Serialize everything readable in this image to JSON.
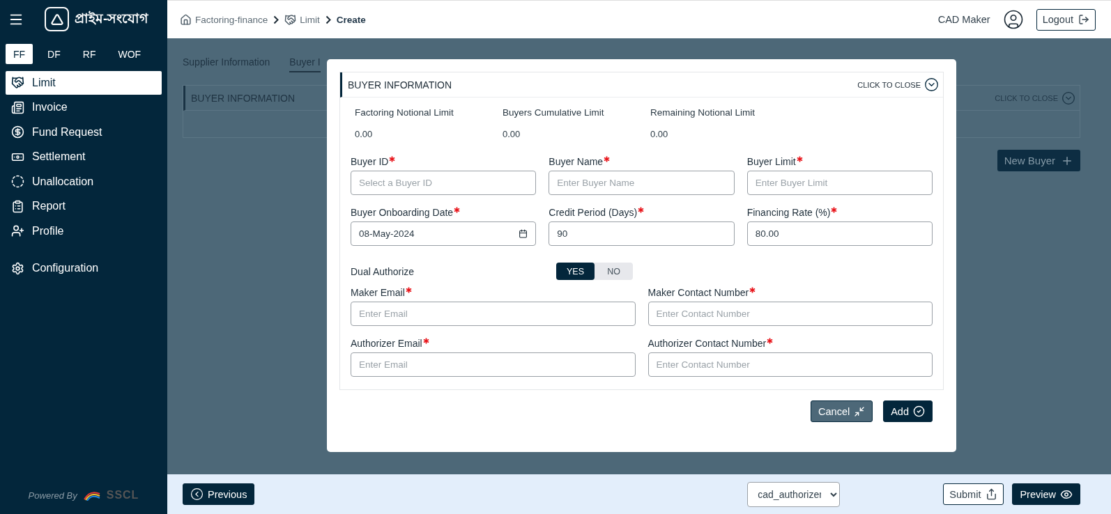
{
  "sidebar": {
    "brand": "প্রাইম-সংযোগ",
    "product_tabs": [
      {
        "label": "FF",
        "selected": true
      },
      {
        "label": "DF",
        "selected": false
      },
      {
        "label": "RF",
        "selected": false
      },
      {
        "label": "WOF",
        "selected": false
      }
    ],
    "items": [
      {
        "label": "Limit",
        "selected": true
      },
      {
        "label": "Invoice",
        "selected": false
      },
      {
        "label": "Fund Request",
        "selected": false
      },
      {
        "label": "Settlement",
        "selected": false
      },
      {
        "label": "Unallocation",
        "selected": false
      },
      {
        "label": "Report",
        "selected": false
      },
      {
        "label": "Profile",
        "selected": false
      }
    ],
    "footer_items": [
      {
        "label": "Configuration",
        "selected": false
      }
    ],
    "powered_by": "Powered By",
    "powered_logo": "SSCL"
  },
  "header": {
    "breadcrumb": [
      {
        "label": "Factoring-finance"
      },
      {
        "label": "Limit"
      },
      {
        "label": "Create"
      }
    ],
    "user": "CAD Maker",
    "logout": "Logout"
  },
  "page": {
    "tabs": [
      {
        "label": "Supplier Information",
        "selected": false
      },
      {
        "label": "Buyer I",
        "selected": true
      }
    ],
    "panel": {
      "title": "BUYER INFORMATION",
      "close_label": "CLICK TO CLOSE"
    },
    "new_buyer": "New Buyer"
  },
  "modal": {
    "title": "BUYER INFORMATION",
    "close_label": "CLICK TO CLOSE",
    "stats": [
      {
        "label": "Factoring Notional Limit",
        "value": "0.00"
      },
      {
        "label": "Buyers Cumulative Limit",
        "value": "0.00"
      },
      {
        "label": "Remaining Notional Limit",
        "value": "0.00"
      }
    ],
    "fields": [
      {
        "label": "Buyer ID",
        "kind": "text",
        "required": true,
        "placeholder": "Select a Buyer ID"
      },
      {
        "label": "Buyer Name",
        "kind": "text",
        "required": true,
        "placeholder": "Enter Buyer Name"
      },
      {
        "label": "Buyer Limit",
        "kind": "text",
        "required": true,
        "placeholder": "Enter Buyer Limit"
      },
      {
        "label": "Buyer Onboarding Date",
        "kind": "date",
        "required": true,
        "value": "08-May-2024"
      },
      {
        "label": "Credit Period (Days)",
        "kind": "text",
        "required": true,
        "value": "90"
      },
      {
        "label": "Financing Rate (%)",
        "kind": "text",
        "required": true,
        "value": "80.00"
      }
    ],
    "dual_authorize": {
      "label": "Dual Authorize",
      "options": [
        {
          "label": "YES",
          "selected": true
        },
        {
          "label": "NO",
          "selected": false
        }
      ]
    },
    "contact_fields": [
      {
        "label": "Maker Email",
        "kind": "text",
        "required": true,
        "placeholder": "Enter Email"
      },
      {
        "label": "Maker Contact Number",
        "kind": "text",
        "required": true,
        "placeholder": "Enter Contact Number"
      },
      {
        "label": "Authorizer Email",
        "kind": "text",
        "required": true,
        "placeholder": "Enter Email"
      },
      {
        "label": "Authorizer Contact Number",
        "kind": "text",
        "required": true,
        "placeholder": "Enter Contact Number"
      }
    ],
    "cancel": "Cancel",
    "add": "Add"
  },
  "footer": {
    "previous": "Previous",
    "role": "cad_authorizer",
    "submit": "Submit",
    "preview": "Preview"
  }
}
